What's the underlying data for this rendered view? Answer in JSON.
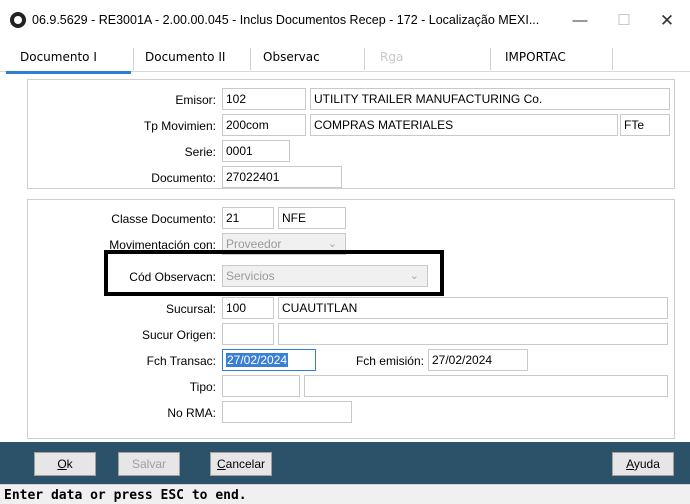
{
  "window": {
    "title": "06.9.5629 - RE3001A - 2.00.00.045 - Inclus Documentos Recep - 172 - Localização MEXI...",
    "minimize": "—",
    "maximize": "☐",
    "close": "✕"
  },
  "tabs": [
    {
      "label": "Documento I",
      "active": true,
      "enabled": true
    },
    {
      "label": "Documento II",
      "active": false,
      "enabled": true
    },
    {
      "label": "Observac",
      "active": false,
      "enabled": true
    },
    {
      "label": "Rga",
      "active": false,
      "enabled": false
    },
    {
      "label": "IMPORTAC",
      "active": false,
      "enabled": true
    }
  ],
  "header_group": {
    "emisor": {
      "label": "Emisor:",
      "code": "102",
      "name": "UTILITY TRAILER MANUFACTURING Co."
    },
    "tp_movimien": {
      "label": "Tp Movimien:",
      "code": "200com",
      "name": "COMPRAS MATERIALES",
      "extra": "FTe"
    },
    "serie": {
      "label": "Serie:",
      "value": "0001"
    },
    "documento": {
      "label": "Documento:",
      "value": "27022401"
    }
  },
  "detail_group": {
    "classe_documento": {
      "label": "Classe Documento:",
      "code": "21",
      "name": "NFE"
    },
    "movimentacion_con": {
      "label": "Movimentación con:",
      "value": "Proveedor"
    },
    "cod_observacn": {
      "label": "Cód Observacn:",
      "value": "Servicios"
    },
    "sucursal": {
      "label": "Sucursal:",
      "code": "100",
      "name": "CUAUTITLAN"
    },
    "sucur_origen": {
      "label": "Sucur Origen:",
      "code": "",
      "name": ""
    },
    "fch_transac": {
      "label": "Fch Transac:",
      "value": "27/02/2024"
    },
    "fch_emision": {
      "label": "Fch emisión:",
      "value": "27/02/2024"
    },
    "tipo": {
      "label": "Tipo:",
      "code": "",
      "name": ""
    },
    "no_rma": {
      "label": "No RMA:",
      "value": ""
    }
  },
  "buttons": {
    "ok": {
      "mnemonic": "O",
      "rest": "k"
    },
    "salvar": {
      "label": "Salvar"
    },
    "cancelar": {
      "mnemonic": "C",
      "rest": "ancelar"
    },
    "ayuda": {
      "mnemonic": "A",
      "rest": "yuda"
    }
  },
  "status": {
    "text": "Enter data or press ESC to end."
  },
  "colors": {
    "accent": "#2f7fd0",
    "button_bar": "#2b5268",
    "selection": "#3a7fd6"
  }
}
